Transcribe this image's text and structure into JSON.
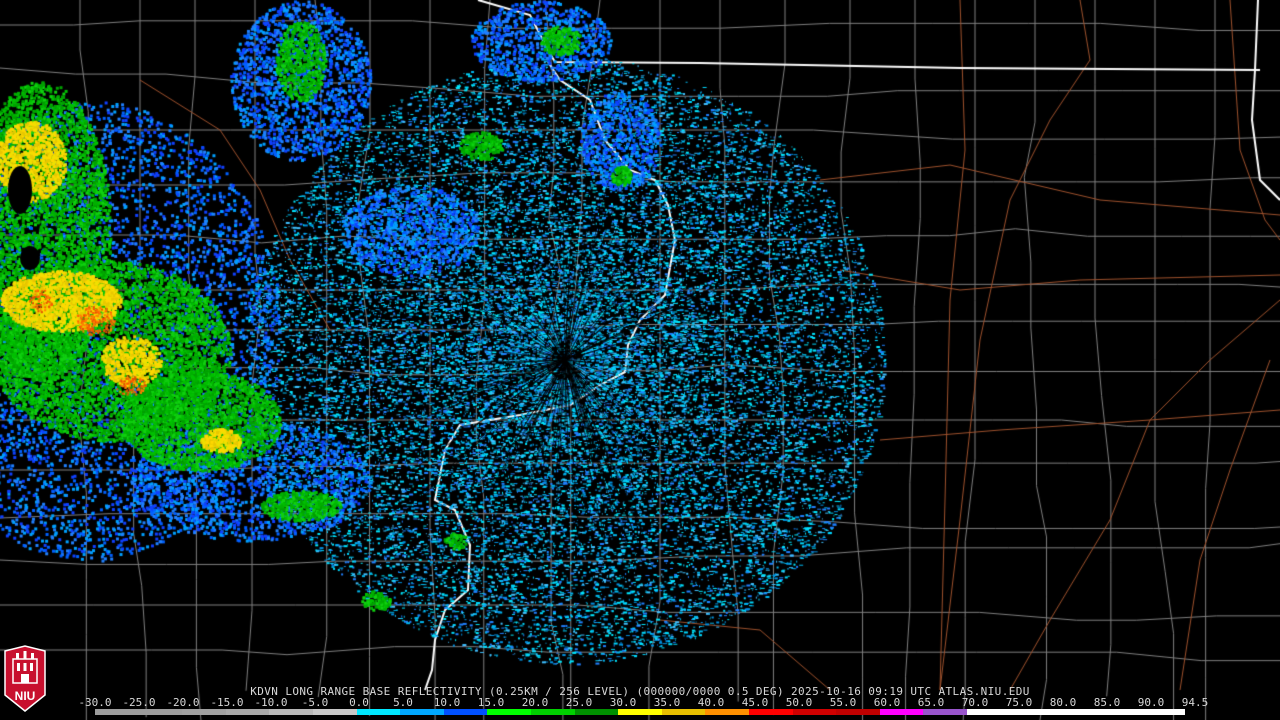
{
  "caption": {
    "station": "KDVN",
    "product": "LONG RANGE BASE REFLECTIVITY",
    "resolution": "(0.25KM / 256 LEVEL)",
    "code": "(000000/0000",
    "elevation": "0.5 DEG)",
    "datetime": "2025-10-16 09:19 UTC",
    "source": "ATLAS.NIU.EDU"
  },
  "logo": {
    "text": "NIU",
    "colors": {
      "bg": "#c8102e",
      "fg": "#ffffff"
    }
  },
  "scale": {
    "labels": [
      "-30.0",
      "-25.0",
      "-20.0",
      "-15.0",
      "-10.0",
      "-5.0",
      "0.0",
      "5.0",
      "10.0",
      "15.0",
      "20.0",
      "25.0",
      "30.0",
      "35.0",
      "40.0",
      "45.0",
      "50.0",
      "55.0",
      "60.0",
      "65.0",
      "70.0",
      "75.0",
      "80.0",
      "85.0",
      "90.0",
      "94.5"
    ],
    "colors": [
      "#9c9c9c",
      "#9c9c9c",
      "#a0a0a0",
      "#a8a8a8",
      "#b8b8b8",
      "#c8c8c8",
      "#00e8ff",
      "#00a8ff",
      "#0050ff",
      "#00ff00",
      "#00d000",
      "#009000",
      "#ffff00",
      "#e8c000",
      "#ff9000",
      "#ff0000",
      "#d00000",
      "#c00000",
      "#ff00ff",
      "#9955cc",
      "#ffffff",
      "#ffffff",
      "#ffffff",
      "#ffffff",
      "#ffffff"
    ]
  },
  "colors": {
    "background": "#000000",
    "county_lines": "#808080",
    "state_lines": "#ffffff",
    "roads": "#a0522d"
  }
}
